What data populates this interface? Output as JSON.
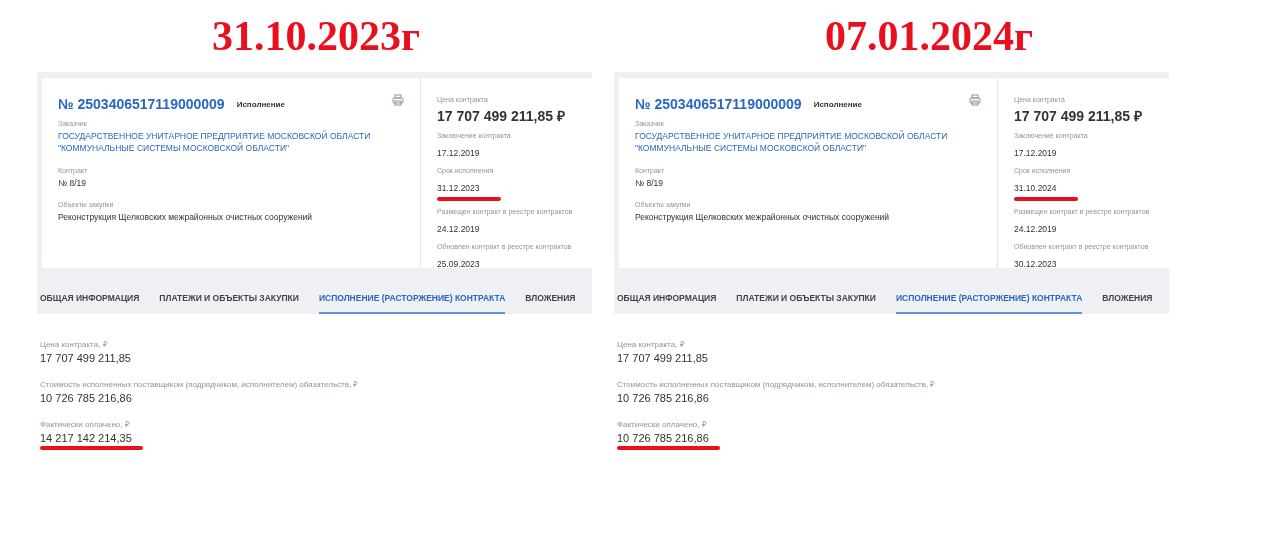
{
  "panels": [
    {
      "heading": "31.10.2023г",
      "number": "№ 2503406517119000009",
      "status": "Исполнение",
      "fields": [
        {
          "label": "Заказчик",
          "value": "ГОСУДАРСТВЕННОЕ УНИТАРНОЕ ПРЕДПРИЯТИЕ МОСКОВСКОЙ ОБЛАСТИ \"КОММУНАЛЬНЫЕ СИСТЕМЫ МОСКОВСКОЙ ОБЛАСТИ\"",
          "kind": "link"
        },
        {
          "label": "Контракт",
          "value": "№ 8/19",
          "kind": "text"
        },
        {
          "label": "Объекты закупки",
          "value": "Реконструкция Щелковских межрайонных очистных сооружений",
          "kind": "text"
        }
      ],
      "side": [
        {
          "label": "Цена контракта",
          "value": "17 707 499 211,85 ₽",
          "kind": "price",
          "underlined": false
        },
        {
          "label": "Заключение контракта",
          "value": "17.12.2019",
          "kind": "date",
          "underlined": false
        },
        {
          "label": "Срок исполнения",
          "value": "31.12.2023",
          "kind": "date",
          "underlined": true
        },
        {
          "label": "Размещен контракт в реестре контрактов",
          "value": "24.12.2019",
          "kind": "date",
          "underlined": false
        },
        {
          "label": "Обновлен контракт в реестре контрактов",
          "value": "25.09.2023",
          "kind": "date",
          "underlined": false
        }
      ],
      "tabs": [
        {
          "label": "ОБЩАЯ ИНФОРМАЦИЯ",
          "selected": false
        },
        {
          "label": "ПЛАТЕЖИ И ОБЪЕКТЫ ЗАКУПКИ",
          "selected": false
        },
        {
          "label": "ИСПОЛНЕНИЕ (РАСТОРЖЕНИЕ) КОНТРАКТА",
          "selected": true
        },
        {
          "label": "ВЛОЖЕНИЯ",
          "selected": false
        }
      ],
      "details": [
        {
          "label": "Цена контракта, ₽",
          "value": "17 707 499 211,85",
          "underlined": false
        },
        {
          "label": "Стоимость исполненных поставщиком (подрядчиком, исполнителем) обязательств, ₽",
          "value": "10 726 785 216,86",
          "underlined": false
        },
        {
          "label": "Фактически оплачено, ₽",
          "value": "14 217 142 214,35",
          "underlined": true
        }
      ]
    },
    {
      "heading": "07.01.2024г",
      "number": "№ 2503406517119000009",
      "status": "Исполнение",
      "fields": [
        {
          "label": "Заказчик",
          "value": "ГОСУДАРСТВЕННОЕ УНИТАРНОЕ ПРЕДПРИЯТИЕ МОСКОВСКОЙ ОБЛАСТИ \"КОММУНАЛЬНЫЕ СИСТЕМЫ МОСКОВСКОЙ ОБЛАСТИ\"",
          "kind": "link"
        },
        {
          "label": "Контракт",
          "value": "№ 8/19",
          "kind": "text"
        },
        {
          "label": "Объекты закупки",
          "value": "Реконструкция Щелковских межрайонных очистных сооружений",
          "kind": "text"
        }
      ],
      "side": [
        {
          "label": "Цена контракта",
          "value": "17 707 499 211,85 ₽",
          "kind": "price",
          "underlined": false
        },
        {
          "label": "Заключение контракта",
          "value": "17.12.2019",
          "kind": "date",
          "underlined": false
        },
        {
          "label": "Срок исполнения",
          "value": "31.10.2024",
          "kind": "date",
          "underlined": true
        },
        {
          "label": "Размещен контракт в реестре контрактов",
          "value": "24.12.2019",
          "kind": "date",
          "underlined": false
        },
        {
          "label": "Обновлен контракт в реестре контрактов",
          "value": "30.12.2023",
          "kind": "date",
          "underlined": false
        }
      ],
      "tabs": [
        {
          "label": "ОБЩАЯ ИНФОРМАЦИЯ",
          "selected": false
        },
        {
          "label": "ПЛАТЕЖИ И ОБЪЕКТЫ ЗАКУПКИ",
          "selected": false
        },
        {
          "label": "ИСПОЛНЕНИЕ (РАСТОРЖЕНИЕ) КОНТРАКТА",
          "selected": true
        },
        {
          "label": "ВЛОЖЕНИЯ",
          "selected": false
        }
      ],
      "details": [
        {
          "label": "Цена контракта, ₽",
          "value": "17 707 499 211,85",
          "underlined": false
        },
        {
          "label": "Стоимость исполненных поставщиком (подрядчиком, исполнителем) обязательств, ₽",
          "value": "10 726 785 216,86",
          "underlined": false
        },
        {
          "label": "Фактически оплачено, ₽",
          "value": "10 726 785 216,86",
          "underlined": true
        }
      ]
    }
  ]
}
